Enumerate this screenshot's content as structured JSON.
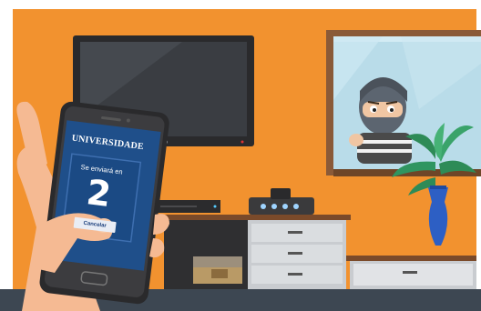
{
  "phone": {
    "app_title": "UNIVERSIDADE",
    "dialog_label": "Se enviará en",
    "countdown": "2",
    "cancel_label": "Cancelar"
  },
  "colors": {
    "wall": "#f2922f",
    "floor": "#3d4752",
    "screen": "#1f4f8a",
    "skin": "#f5ba93"
  }
}
